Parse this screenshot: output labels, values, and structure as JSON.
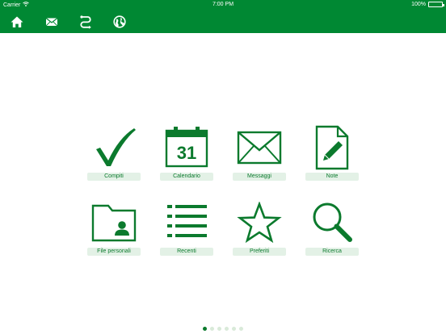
{
  "status_bar": {
    "carrier": "Carrier",
    "time": "7:00 PM",
    "battery": "100%",
    "battery_level": 1.0
  },
  "toolbar": {
    "items": [
      {
        "icon": "home-icon"
      },
      {
        "icon": "mail-icon"
      },
      {
        "icon": "route-icon"
      },
      {
        "icon": "globe-icon"
      }
    ]
  },
  "grid": {
    "tiles": [
      {
        "label": "Compiti",
        "icon": "checkmark-icon"
      },
      {
        "label": "Calendario",
        "icon": "calendar-icon",
        "day": "31"
      },
      {
        "label": "Messaggi",
        "icon": "envelope-icon"
      },
      {
        "label": "Note",
        "icon": "note-pencil-icon"
      },
      {
        "label": "File personali",
        "icon": "personal-folder-icon"
      },
      {
        "label": "Recenti",
        "icon": "list-icon"
      },
      {
        "label": "Preferiti",
        "icon": "star-icon"
      },
      {
        "label": "Ricerca",
        "icon": "magnifier-icon"
      }
    ]
  },
  "pager": {
    "pages": 6,
    "current": 1
  },
  "colors": {
    "header": "#008833",
    "accent": "#0b7a2d",
    "label_bg": "#e3f1e6",
    "dot_inactive": "#d9ead9"
  }
}
